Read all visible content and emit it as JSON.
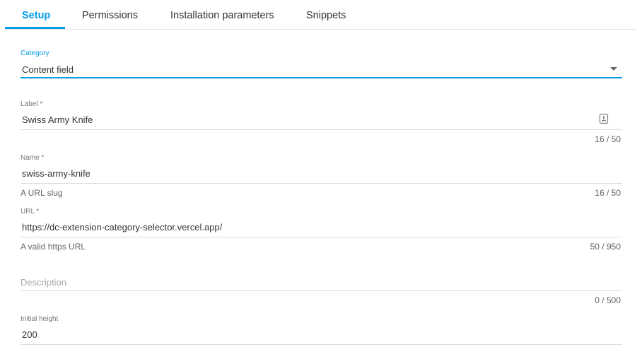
{
  "tabs": [
    {
      "label": "Setup",
      "active": true
    },
    {
      "label": "Permissions",
      "active": false
    },
    {
      "label": "Installation parameters",
      "active": false
    },
    {
      "label": "Snippets",
      "active": false
    }
  ],
  "form": {
    "category": {
      "label": "Category",
      "value": "Content field"
    },
    "label": {
      "label": "Label *",
      "value": "Swiss Army Knife",
      "counter": "16 / 50",
      "icon": "text-field-icon"
    },
    "name": {
      "label": "Name *",
      "value": "swiss-army-knife",
      "helper": "A URL slug",
      "counter": "16 / 50"
    },
    "url": {
      "label": "URL *",
      "value": "https://dc-extension-category-selector.vercel.app/",
      "helper": "A valid https URL",
      "counter": "50 / 950"
    },
    "description": {
      "placeholder": "Description",
      "value": "",
      "counter": "0 / 500"
    },
    "initial_height": {
      "label": "Initial height",
      "value": "200"
    }
  },
  "colors": {
    "accent": "#039be5"
  }
}
